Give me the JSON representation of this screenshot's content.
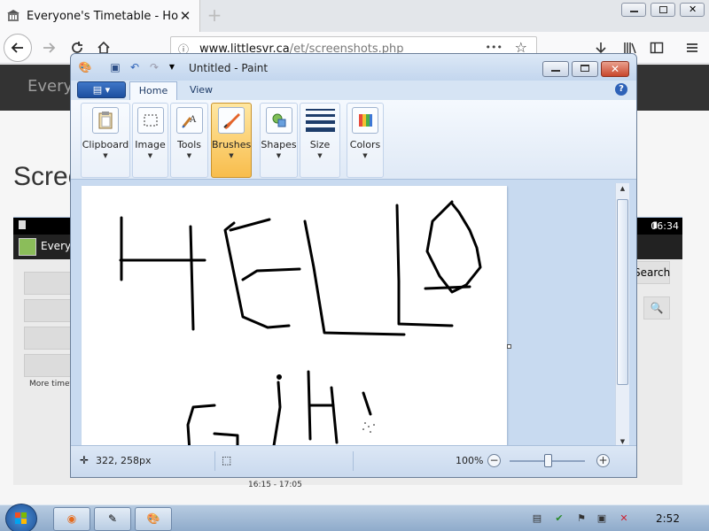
{
  "browser": {
    "tab_title": "Everyone's Timetable - Home",
    "tab_close": "✕",
    "new_tab": "+",
    "url_host": "www.littlesvr.ca",
    "url_path": "/et/screenshots.php",
    "url_info": "ⓘ",
    "page_actions": "•••"
  },
  "page": {
    "brand": "Everyo",
    "heading": "Scree",
    "phone": {
      "status_time": "06:34",
      "app_title": "Everyo",
      "search_label": "Search",
      "more_link": "More timeta",
      "time_range": "16:15 - 17:05"
    }
  },
  "paint": {
    "window_title": "Untitled - Paint",
    "file_menu": "▤ ▾",
    "tabs": [
      "Home",
      "View"
    ],
    "help": "?",
    "groups": [
      "Clipboard",
      "Image",
      "Tools",
      "Brushes",
      "Shapes",
      "Size",
      "Colors"
    ],
    "cursor_position": "322, 258px",
    "zoom": "100%",
    "zoom_out": "−",
    "zoom_in": "+"
  },
  "taskbar": {
    "clock": "2:52"
  },
  "colors": {
    "accent_active_group": "#f8bd4c",
    "ink": "#000000"
  }
}
